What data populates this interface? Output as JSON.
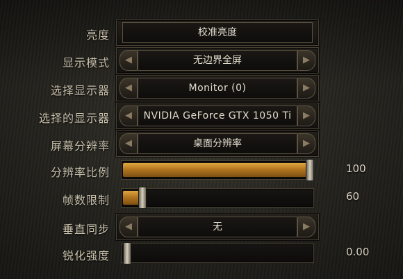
{
  "settings": {
    "brightness": {
      "label": "亮度",
      "value": "校准亮度"
    },
    "display_mode": {
      "label": "显示模式",
      "value": "无边界全屏"
    },
    "select_display": {
      "label": "选择显示器",
      "value": "Monitor (0)"
    },
    "selected_display": {
      "label": "选择的显示器",
      "value": "NVIDIA GeForce GTX 1050 Ti"
    },
    "screen_resolution": {
      "label": "屏幕分辨率",
      "value": "桌面分辨率"
    },
    "resolution_scale": {
      "label": "分辨率比例",
      "value": "100",
      "level": 1.0
    },
    "frame_limit": {
      "label": "帧数限制",
      "value": "60",
      "level": 0.1
    },
    "vsync": {
      "label": "垂直同步",
      "value": "无"
    },
    "sharpening": {
      "label": "锐化强度",
      "value": "0.00",
      "level": 0.0
    }
  },
  "icons": {
    "left_arrow": "chevron-left-icon",
    "right_arrow": "chevron-right-icon"
  },
  "colors": {
    "label": "#c9c1ad",
    "value": "#e2dccd",
    "slider_fill": "#c98a2c"
  }
}
